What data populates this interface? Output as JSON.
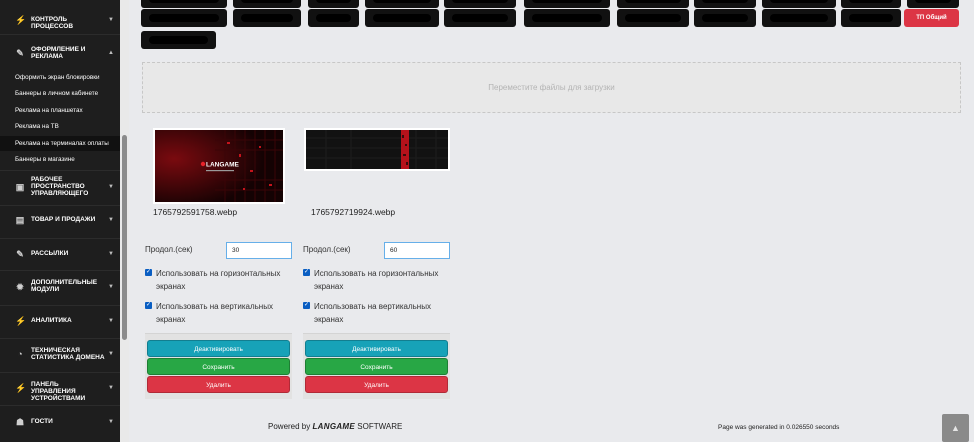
{
  "sidebar": {
    "items": [
      {
        "label": "Контроль процессов",
        "icon": "bolt-icon"
      },
      {
        "label": "Оформление и реклама",
        "icon": "edit-square-icon"
      },
      {
        "label": "Рабочее пространство управляющего",
        "icon": "briefcase-icon"
      },
      {
        "label": "Товар и продажи",
        "icon": "sticky-note-icon"
      },
      {
        "label": "Рассылки",
        "icon": "edit-square-icon"
      },
      {
        "label": "Дополнительные модули",
        "icon": "gear-icon"
      },
      {
        "label": "Аналитика",
        "icon": "bolt-icon"
      },
      {
        "label": "Техническая статистика домена",
        "icon": "pie-chart-icon"
      },
      {
        "label": "Панель управления устройствами",
        "icon": "bolt-icon"
      },
      {
        "label": "Гости",
        "icon": "users-icon"
      }
    ],
    "subitems": [
      {
        "label": "Оформить экран блокировки"
      },
      {
        "label": "Баннеры в личном кабинете"
      },
      {
        "label": "Реклама на планшетах"
      },
      {
        "label": "Реклама на ТВ"
      },
      {
        "label": "Реклама на терминалах оплаты"
      },
      {
        "label": "Баннеры в магазине"
      }
    ],
    "active_subitem": "Реклама на терминалах оплаты"
  },
  "tags": {
    "active_label": "ТП Общий"
  },
  "dropzone": {
    "text": "Переместите файлы для загрузки"
  },
  "banners": [
    {
      "filename": "1765792591758.webp",
      "duration_label": "Продол.(сек)",
      "duration_value": "30",
      "horizontal_label": "Использовать на горизонтальных экранах",
      "horizontal_checked": true,
      "vertical_label": "Использовать на вертикальных экранах",
      "vertical_checked": true,
      "deactivate_label": "Деактивировать",
      "save_label": "Сохранить",
      "delete_label": "Удалить",
      "image_text": "LANGAME"
    },
    {
      "filename": "1765792719924.webp",
      "duration_label": "Продол.(сек)",
      "duration_value": "60",
      "horizontal_label": "Использовать на горизонтальных экранах",
      "horizontal_checked": true,
      "vertical_label": "Использовать на вертикальных экранах",
      "vertical_checked": true,
      "deactivate_label": "Деактивировать",
      "save_label": "Сохранить",
      "delete_label": "Удалить",
      "image_text": ""
    }
  ],
  "footer": {
    "powered_prefix": "Powered by",
    "powered_brand": "LANGAME",
    "powered_suffix": "SOFTWARE",
    "generated_text": "Page was generated in 0.026550 seconds"
  },
  "colors": {
    "sidebar_bg": "#1e1e1e",
    "accent_red": "#dc3545",
    "accent_teal": "#17a2b8",
    "accent_green": "#28a745"
  }
}
